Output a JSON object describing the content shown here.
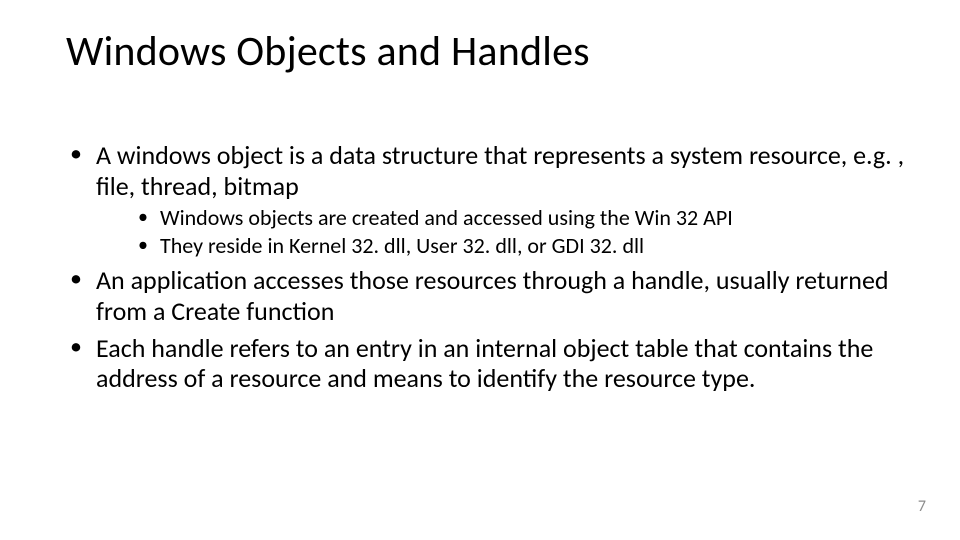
{
  "title": "Windows Objects and Handles",
  "bullets": {
    "b1": "A windows object is a data structure that represents a system resource, e.g. , file, thread, bitmap",
    "b1_sub1": "Windows objects are created and accessed using the Win 32 API",
    "b1_sub2": "They reside in Kernel 32. dll, User 32. dll, or GDI 32. dll",
    "b2": "An application accesses those resources through a handle, usually returned from a Create function",
    "b3": "Each handle refers to an entry in an internal object table that contains the address of a resource and means to identify the resource type."
  },
  "page_number": "7"
}
